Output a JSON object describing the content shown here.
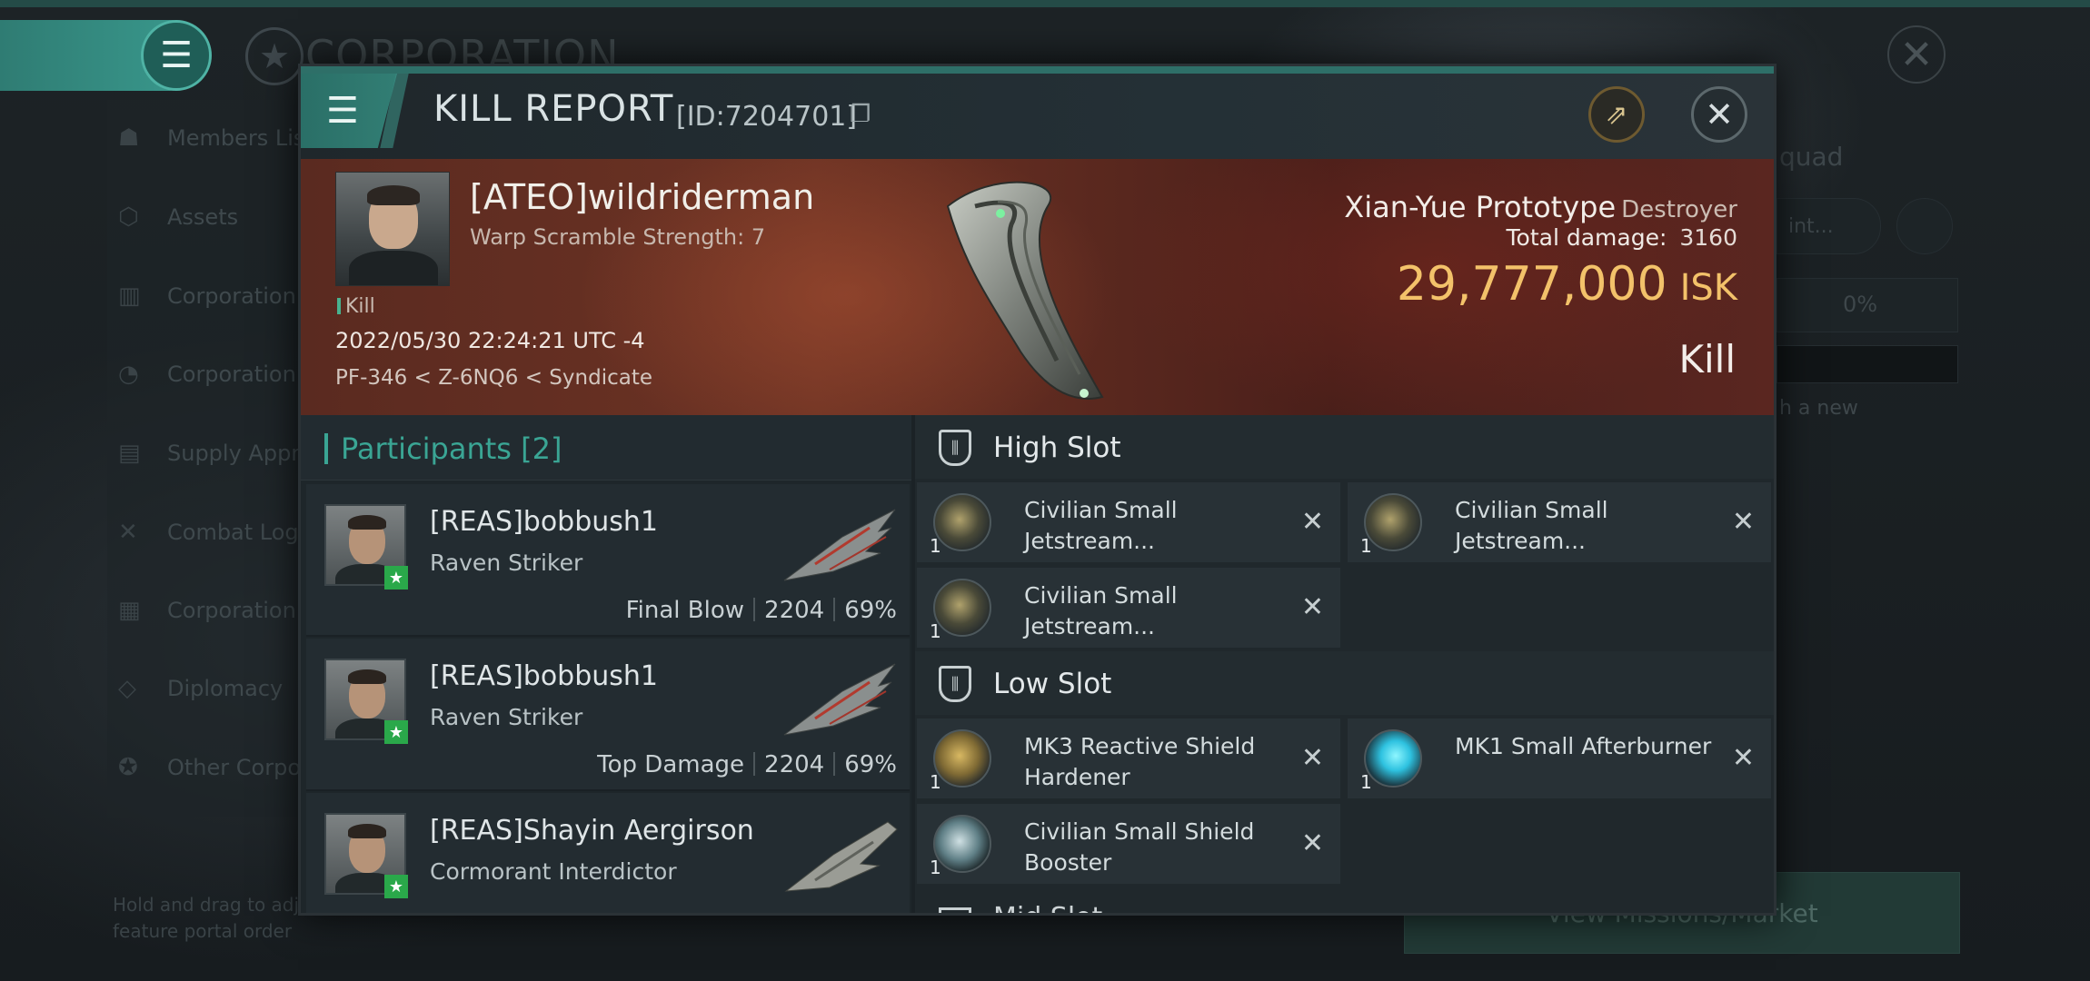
{
  "background": {
    "title": "CORPORATION",
    "sidebar": [
      {
        "label": "Members List",
        "icon": "members-icon"
      },
      {
        "label": "Assets",
        "icon": "assets-icon"
      },
      {
        "label": "Corporation",
        "icon": "corporation-chart-icon"
      },
      {
        "label": "Corporation",
        "icon": "corporation-pie-icon"
      },
      {
        "label": "Supply Appro",
        "icon": "supply-icon"
      },
      {
        "label": "Combat Log",
        "icon": "combat-log-icon"
      },
      {
        "label": "Corporation",
        "icon": "corporation-doc-icon"
      },
      {
        "label": "Diplomacy",
        "icon": "diplomacy-icon"
      },
      {
        "label": "Other Corpor",
        "icon": "other-corp-icon"
      }
    ],
    "hint": "Hold and drag to adju\nfeature portal order",
    "right": {
      "squad": "quad",
      "int": "int...",
      "percent": "0%",
      "new_text": "h a new",
      "missions_button": "View Missions/Market"
    }
  },
  "dialog": {
    "title": "KILL REPORT",
    "id_text": "[ID:7204701]",
    "victim": {
      "name": "[ATEO]wildriderman",
      "warp_scramble": "Warp Scramble Strength: 7",
      "tag": "Kill",
      "timestamp": "2022/05/30 22:24:21 UTC -4",
      "location": "PF-346 < Z-6NQ6 < Syndicate"
    },
    "ship": {
      "name": "Xian-Yue Prototype",
      "class": "Destroyer",
      "damage_label": "Total damage:",
      "damage_value": "3160",
      "isk_value": "29,777,000",
      "isk_unit": "ISK",
      "result": "Kill"
    },
    "participants": {
      "label": "Participants",
      "count": "[2]",
      "rows": [
        {
          "name": "[REAS]bobbush1",
          "ship": "Raven Striker",
          "role": "Final Blow",
          "damage": "2204",
          "percent": "69%"
        },
        {
          "name": "[REAS]bobbush1",
          "ship": "Raven Striker",
          "role": "Top Damage",
          "damage": "2204",
          "percent": "69%"
        },
        {
          "name": "[REAS]Shayin Aergirson",
          "ship": "Cormorant Interdictor",
          "role": "",
          "damage": "",
          "percent": ""
        }
      ]
    },
    "fittings": {
      "high_slot": {
        "label": "High Slot",
        "modules": [
          {
            "name": "Civilian Small Jetstream...",
            "qty": "1",
            "icon": "jetstream-icon"
          },
          {
            "name": "Civilian Small Jetstream...",
            "qty": "1",
            "icon": "jetstream-icon"
          },
          {
            "name": "Civilian Small Jetstream...",
            "qty": "1",
            "icon": "jetstream-icon"
          }
        ]
      },
      "low_slot": {
        "label": "Low Slot",
        "modules": [
          {
            "name": "MK3 Reactive Shield Hardener",
            "qty": "1",
            "icon": "shield-hardener-icon"
          },
          {
            "name": "MK1 Small Afterburner",
            "qty": "1",
            "icon": "afterburner-icon"
          },
          {
            "name": "Civilian Small Shield Booster",
            "qty": "1",
            "icon": "shield-booster-icon"
          }
        ]
      },
      "mid_slot": {
        "label": "Mid Slot"
      }
    }
  }
}
